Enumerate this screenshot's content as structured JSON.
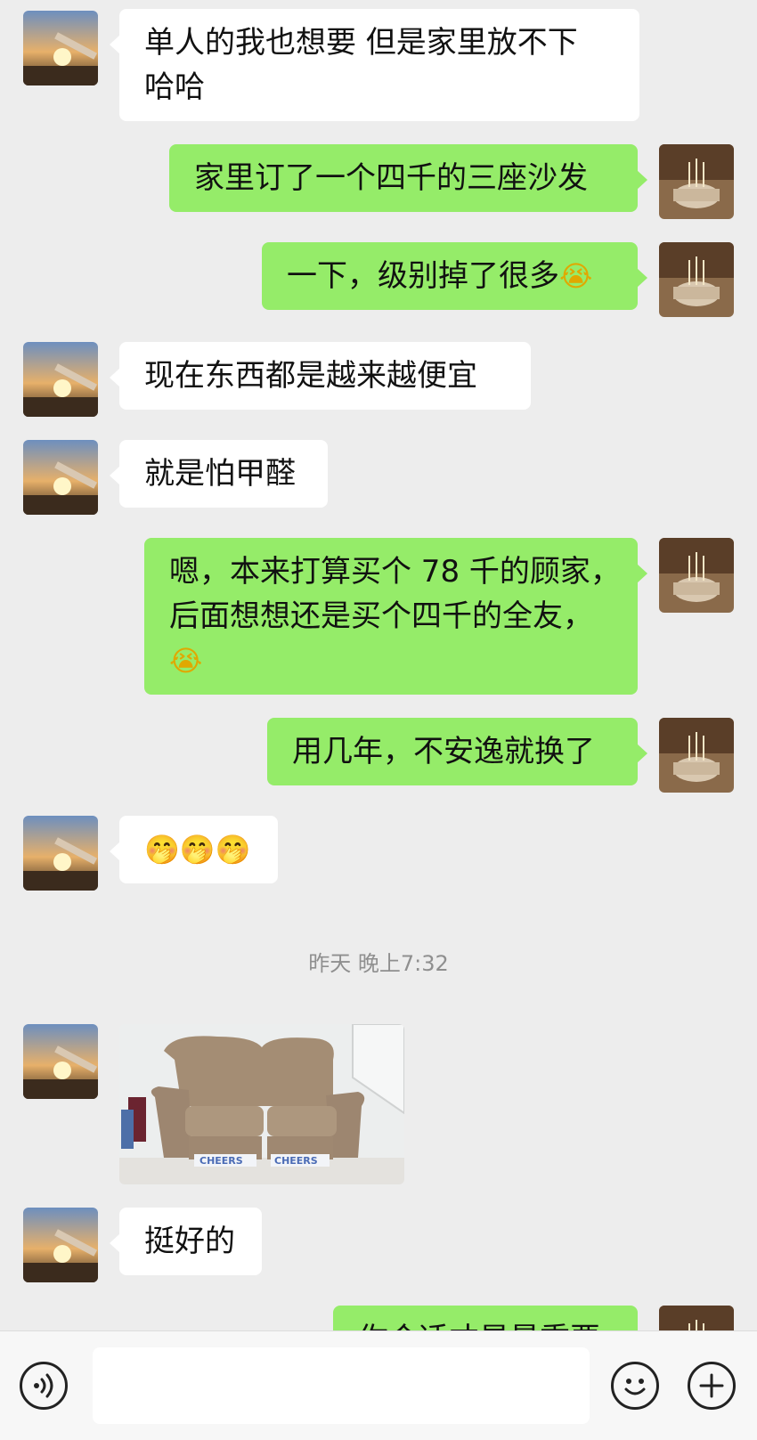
{
  "messages": [
    {
      "id": "m1",
      "dir": "in",
      "lines": [
        "单人的我也想要  但是家里放不下",
        "哈哈"
      ]
    },
    {
      "id": "m2",
      "dir": "out",
      "lines": [
        "家里订了一个四千的三座沙发"
      ]
    },
    {
      "id": "m3",
      "dir": "out",
      "lines": [
        "一下，级别掉了很多"
      ],
      "emoji": "😭"
    },
    {
      "id": "m4",
      "dir": "in",
      "lines": [
        "现在东西都是越来越便宜"
      ]
    },
    {
      "id": "m5",
      "dir": "in",
      "lines": [
        "就是怕甲醛"
      ]
    },
    {
      "id": "m6",
      "dir": "out",
      "lines": [
        "嗯，本来打算买个 78 千的顾家，",
        "后面想想还是买个四千的全友，"
      ],
      "emoji": "😭"
    },
    {
      "id": "m7",
      "dir": "out",
      "lines": [
        "用几年，不安逸就换了"
      ]
    },
    {
      "id": "m8",
      "dir": "in",
      "lines": [],
      "emoji": "🤭🤭🤭"
    },
    {
      "id": "m9",
      "dir": "in",
      "type": "image",
      "image_text": "CHEERS"
    },
    {
      "id": "m10",
      "dir": "in",
      "lines": [
        "挺好的"
      ]
    },
    {
      "id": "m11",
      "dir": "out",
      "lines": [
        "你合适才是最重要"
      ]
    }
  ],
  "timestamp": "昨天 晚上7:32",
  "input_bar": {
    "voice_icon": "voice-icon",
    "emoji_icon": "emoji-icon",
    "add_icon": "add-icon",
    "input_value": ""
  },
  "colors": {
    "background": "#ededed",
    "incoming_bubble": "#ffffff",
    "outgoing_bubble": "#95ec69"
  }
}
